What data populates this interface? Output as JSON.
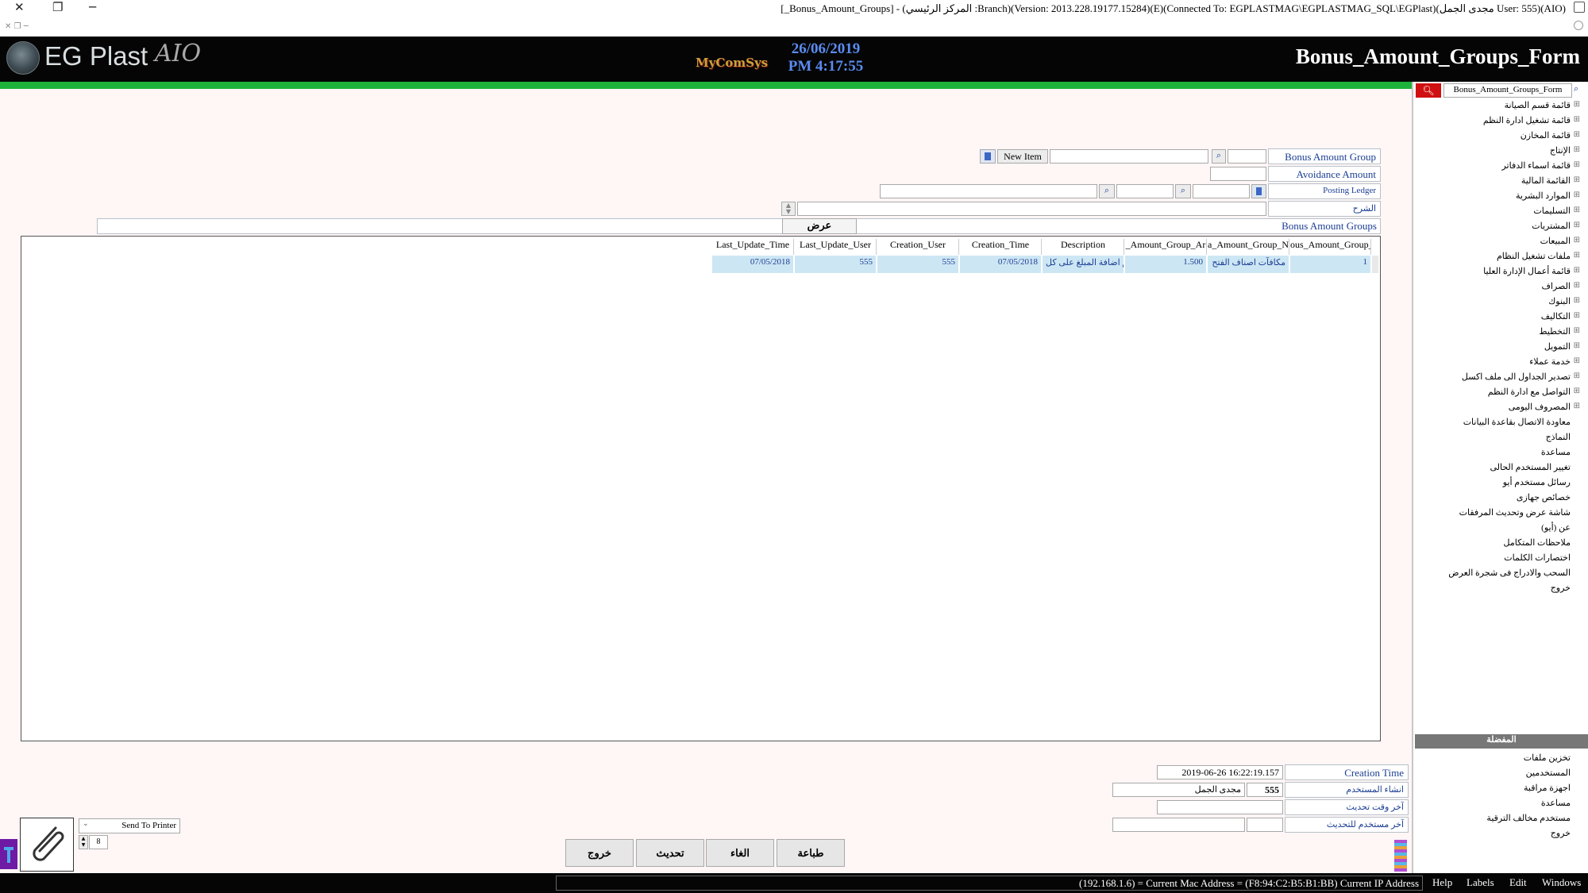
{
  "window": {
    "title": "[_Bonus_Amount_Groups] - (المركز الرئيسي :Branch)(Version: 2013.228.19177.15284)(E)(Connected To: EGPLASTMAG\\EGPLASTMAG_SQL\\EGPlast)(مجدى الجمل User: 555)(AIO)",
    "close_glyph": "✕",
    "restore_glyph": "❐",
    "minimize_glyph": "─"
  },
  "header": {
    "logo_text": "EG Plast",
    "logo_suffix": "AIO",
    "brand": "MyComSys",
    "date": "26/06/2019",
    "time": "PM 4:17:55",
    "form_title": "Bonus_Amount_Groups_Form"
  },
  "form": {
    "bonus_amount_group_label": "Bonus Amount Group",
    "new_item_label": "New Item",
    "avoidance_amount_label": "Avoidance Amount",
    "posting_ledger_label": "Posting Ledger",
    "description_label": "الشرح",
    "groups_label": "Bonus Amount Groups",
    "show_button": "عرض"
  },
  "grid": {
    "columns": [
      "ous_Amount_Group_",
      "a_Amount_Group_N",
      "_Amount_Group_Ar",
      "Description",
      "Creation_Time",
      "Creation_User",
      "Last_Update_User",
      "Last_Update_Time"
    ],
    "rows": [
      [
        "1",
        "مكافآت اصناف الفتح",
        "1.500",
        "يتم اضافة المبلغ على كل",
        "07/05/2018",
        "555",
        "555",
        "07/05/2018"
      ]
    ]
  },
  "audit": {
    "creation_time_label": "Creation Time",
    "creation_time_value": "2019-06-26 16:22:19.157",
    "created_by_label": "انشاء المستخدم",
    "created_by_id": "555",
    "created_by_name": "مجدى الجمل",
    "last_update_time_label": "آخر وقت تحديث",
    "last_update_user_label": "آخر مستخدم للتحديث"
  },
  "actions": {
    "print": "طباعة",
    "cancel": "الغاء",
    "update": "تحديث",
    "exit": "خروج"
  },
  "printer": {
    "send_to_printer": "Send To Printer",
    "copies": "8"
  },
  "sidebar": {
    "search_value": "Bonus_Amount_Groups_Form",
    "tree": [
      "قائمة قسم الصيانة",
      "قائمة تشغيل ادارة النظم",
      "قائمة المخازن",
      "الإنتاج",
      "قائمة اسماء الدفاتر",
      "القائمة المالية",
      "الموارد البشرية",
      "التسليمات",
      "المشتريات",
      "المبيعات",
      "ملفات تشغيل النظام",
      "قائمة أعمال الإدارة العليا",
      "الصراف",
      "البنوك",
      "التكاليف",
      "التخطيط",
      "التمويل",
      "خدمة عملاء",
      "تصدير الجداول الى ملف اكسل",
      "التواصل مع ادارة النظم",
      "المصروف اليومى"
    ],
    "plain": [
      "معاودة الاتصال بقاعدة البيانات",
      "النماذج",
      "مساعدة",
      "تغيير المستخدم الحالى",
      "رسائل مستخدم أيو",
      "خصائص جهازى",
      "شاشة عرض وتحديث المرفقات",
      "عن (أيو)",
      "ملاحظات المتكامل",
      "اختصارات الكلمات",
      "السحب والادراج فى شجرة العرض",
      "خروج"
    ],
    "favorites_title": "المفضلة",
    "favorites": [
      "تخزين ملفات",
      "المستخدمين",
      "اجهزة مراقبة",
      "مساعدة",
      "مستخدم مخالف الترقية",
      "خروج"
    ]
  },
  "statusbar": {
    "menu": [
      "Windows",
      "Edit",
      "Labels",
      "Help"
    ],
    "info": "(192.168.1.6) = Current Mac Address = (F8:94:C2:B5:B1:BB) Current IP Address"
  }
}
